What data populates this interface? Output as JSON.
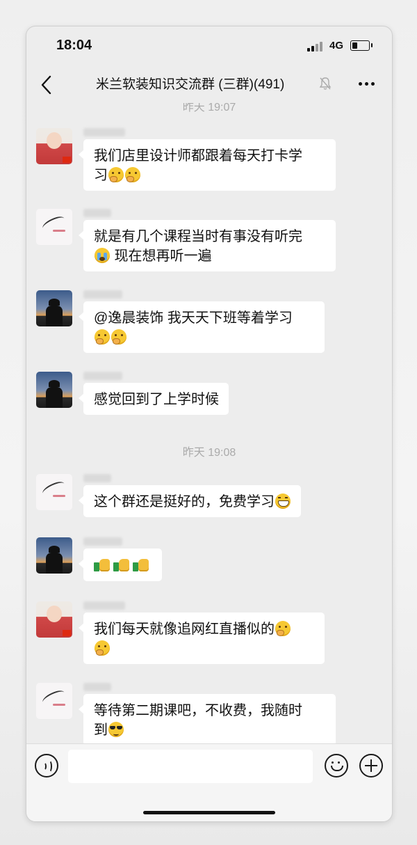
{
  "status": {
    "time": "18:04",
    "network": "4G"
  },
  "nav": {
    "title": "米兰软装知识交流群 (三群)(491)"
  },
  "chat": {
    "cut_timestamp": "昨天 19:07",
    "messages": [
      {
        "sender": "baby",
        "segments": [
          "我们店里设计师都跟着每天打卡学",
          "习",
          ""
        ],
        "emoji": [
          "think",
          "think"
        ]
      },
      {
        "sender": "ink",
        "segments": [
          "就是有几个课程当时有事没有听完",
          " 现在想再听一遍"
        ],
        "emoji": [
          "cry"
        ]
      },
      {
        "sender": "sunset",
        "segments": [
          "@逸晨装饰 我天天下班等着学习",
          ""
        ],
        "emoji": [
          "think",
          "think"
        ]
      },
      {
        "sender": "sunset",
        "segments": [
          "感觉回到了上学时候"
        ]
      },
      {
        "sender": "ink",
        "segments": [
          "这个群还是挺好的，免费学习"
        ],
        "emoji": [
          "grin"
        ]
      },
      {
        "sender": "sunset",
        "segments": [
          ""
        ],
        "emoji": [
          "thumbs-up",
          "thumbs-up",
          "thumbs-up"
        ]
      },
      {
        "sender": "baby",
        "segments": [
          "我们每天就像追网红直播似的",
          ""
        ],
        "emoji": [
          "think",
          "think"
        ]
      },
      {
        "sender": "ink",
        "segments": [
          "等待第二期课吧，不收费，我随时",
          "到"
        ],
        "emoji": [
          "cool"
        ]
      }
    ],
    "timestamp": "昨天 19:08"
  },
  "input": {
    "placeholder": ""
  },
  "colors": {
    "background": "#ededed",
    "bubble": "#ffffff",
    "input_bar": "#f5f5f5"
  },
  "icons": [
    "back-chevron-icon",
    "mute-bell-icon",
    "more-dots-icon",
    "voice-icon",
    "emoji-icon",
    "plus-icon"
  ]
}
